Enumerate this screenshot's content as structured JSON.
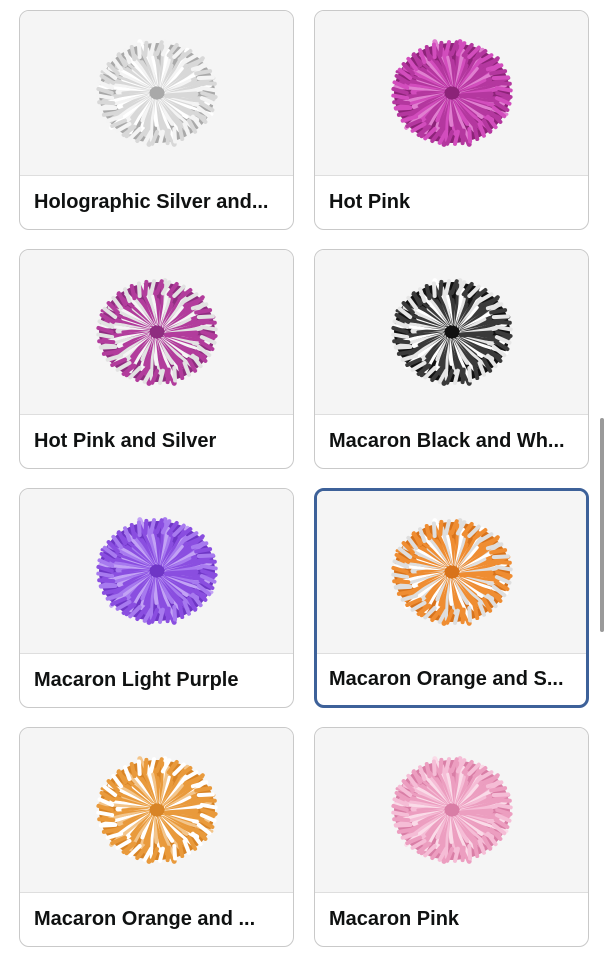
{
  "swatches": [
    {
      "label": "Holographic Silver and...",
      "icon": "silver-pom-pom-icon",
      "colors": [
        "#d8d8d8",
        "#f4f4f4",
        "#a9a9a9",
        "#ffffff"
      ],
      "selected": false
    },
    {
      "label": "Hot Pink",
      "icon": "hot-pink-pom-pom-icon",
      "colors": [
        "#b4379f",
        "#d24dbd",
        "#8c2378",
        "#e07fd0"
      ],
      "selected": false
    },
    {
      "label": "Hot Pink and Silver",
      "icon": "hot-pink-silver-pom-pom-icon",
      "colors": [
        "#b23c9c",
        "#e2e2e2",
        "#8f2d80",
        "#f5f5f5"
      ],
      "selected": false
    },
    {
      "label": "Macaron Black and Wh...",
      "icon": "black-white-pom-pom-icon",
      "colors": [
        "#3a3a3a",
        "#e6e6e6",
        "#111111",
        "#ffffff"
      ],
      "selected": false
    },
    {
      "label": "Macaron Light Purple",
      "icon": "light-purple-pom-pom-icon",
      "colors": [
        "#8a4ee0",
        "#a77aef",
        "#6f36c6",
        "#c2a2f5"
      ],
      "selected": false
    },
    {
      "label": "Macaron Orange and S...",
      "icon": "orange-silver-pom-pom-icon",
      "colors": [
        "#ef8d32",
        "#dedede",
        "#d8731b",
        "#ffffff"
      ],
      "selected": true
    },
    {
      "label": "Macaron Orange and ...",
      "icon": "orange-white-pom-pom-icon",
      "colors": [
        "#e99a3c",
        "#ffffff",
        "#d88426",
        "#f3c58b"
      ],
      "selected": false
    },
    {
      "label": "Macaron Pink",
      "icon": "macaron-pink-pom-pom-icon",
      "colors": [
        "#ec9ec0",
        "#f5bdd6",
        "#d97ea6",
        "#fadbe8"
      ],
      "selected": false
    }
  ],
  "accent_color": "#3d6199"
}
